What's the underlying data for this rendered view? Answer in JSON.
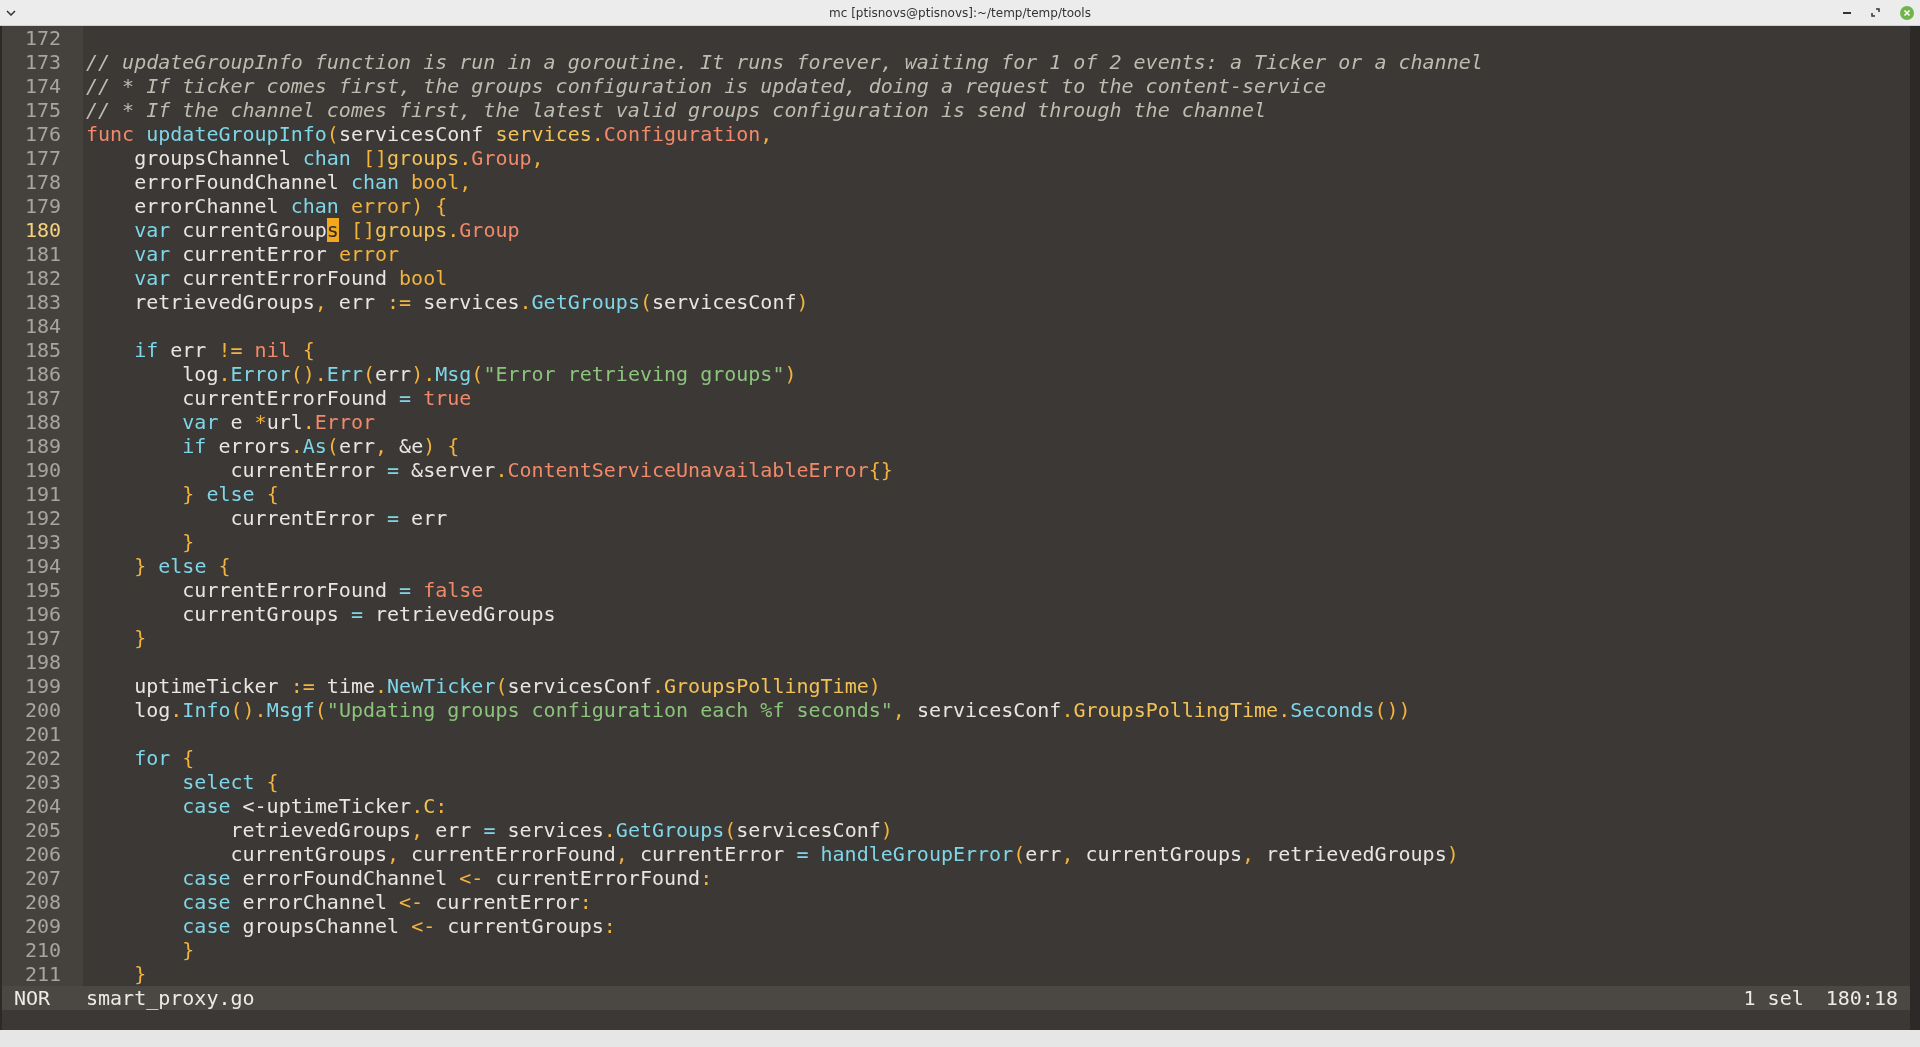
{
  "window": {
    "title": "mc [ptisnovs@ptisnovs]:~/temp/temp/tools"
  },
  "editor": {
    "lines": [
      {
        "number": "172",
        "current": false
      },
      {
        "number": "173",
        "current": false,
        "tokens": [
          {
            "kind": "comment",
            "text": "// updateGroupInfo function is run in a goroutine. It runs forever, waiting for 1 of 2 events: a Ticker or a channel"
          }
        ]
      },
      {
        "number": "174",
        "current": false,
        "tokens": [
          {
            "kind": "comment",
            "text": "// * If ticker comes first, the groups configuration is updated, doing a request to the content-service"
          }
        ]
      },
      {
        "number": "175",
        "current": false,
        "tokens": [
          {
            "kind": "comment",
            "text": "// * If the channel comes first, the latest valid groups configuration is send through the channel"
          }
        ]
      },
      {
        "number": "176",
        "current": false,
        "tokens": [
          {
            "kind": "keyword",
            "text": "func"
          },
          {
            "kind": "function",
            "text": " updateGroupInfo"
          },
          {
            "kind": "punctuation",
            "text": "("
          },
          {
            "kind": "plain",
            "text": "servicesConf "
          },
          {
            "kind": "field",
            "text": "services"
          },
          {
            "kind": "punctuation",
            "text": "."
          },
          {
            "kind": "type",
            "text": "Configuration"
          },
          {
            "kind": "punctuation",
            "text": ","
          }
        ]
      },
      {
        "number": "177",
        "current": false,
        "tokens": [
          {
            "kind": "plain",
            "text": "    groupsChannel "
          },
          {
            "kind": "control",
            "text": "chan"
          },
          {
            "kind": "punctuation",
            "text": " []"
          },
          {
            "kind": "field",
            "text": "groups"
          },
          {
            "kind": "punctuation",
            "text": "."
          },
          {
            "kind": "type",
            "text": "Group"
          },
          {
            "kind": "punctuation",
            "text": ","
          }
        ]
      },
      {
        "number": "178",
        "current": false,
        "tokens": [
          {
            "kind": "plain",
            "text": "    errorFoundChannel "
          },
          {
            "kind": "control",
            "text": "chan"
          },
          {
            "kind": "builtin",
            "text": " bool"
          },
          {
            "kind": "punctuation",
            "text": ","
          }
        ]
      },
      {
        "number": "179",
        "current": false,
        "tokens": [
          {
            "kind": "plain",
            "text": "    errorChannel "
          },
          {
            "kind": "control",
            "text": "chan"
          },
          {
            "kind": "builtin",
            "text": " error"
          },
          {
            "kind": "punctuation",
            "text": ") {"
          }
        ]
      },
      {
        "number": "180",
        "current": true,
        "tokens": [
          {
            "kind": "control",
            "text": "    var"
          },
          {
            "kind": "plain",
            "text": " currentGroup"
          },
          {
            "kind": "cursor",
            "text": "s"
          },
          {
            "kind": "punctuation",
            "text": " []"
          },
          {
            "kind": "field",
            "text": "groups"
          },
          {
            "kind": "punctuation",
            "text": "."
          },
          {
            "kind": "type",
            "text": "Group"
          }
        ]
      },
      {
        "number": "181",
        "current": false,
        "tokens": [
          {
            "kind": "control",
            "text": "    var"
          },
          {
            "kind": "plain",
            "text": " currentError "
          },
          {
            "kind": "builtin",
            "text": "error"
          }
        ]
      },
      {
        "number": "182",
        "current": false,
        "tokens": [
          {
            "kind": "control",
            "text": "    var"
          },
          {
            "kind": "plain",
            "text": " currentErrorFound "
          },
          {
            "kind": "builtin",
            "text": "bool"
          }
        ]
      },
      {
        "number": "183",
        "current": false,
        "tokens": [
          {
            "kind": "plain",
            "text": "    retrievedGroups"
          },
          {
            "kind": "punctuation",
            "text": ","
          },
          {
            "kind": "plain",
            "text": " err "
          },
          {
            "kind": "punctuation",
            "text": ":="
          },
          {
            "kind": "plain",
            "text": " services"
          },
          {
            "kind": "punctuation",
            "text": "."
          },
          {
            "kind": "function",
            "text": "GetGroups"
          },
          {
            "kind": "punctuation",
            "text": "("
          },
          {
            "kind": "plain",
            "text": "servicesConf"
          },
          {
            "kind": "punctuation",
            "text": ")"
          }
        ]
      },
      {
        "number": "184",
        "current": false
      },
      {
        "number": "185",
        "current": false,
        "tokens": [
          {
            "kind": "control",
            "text": "    if"
          },
          {
            "kind": "plain",
            "text": " err "
          },
          {
            "kind": "punctuation",
            "text": "!="
          },
          {
            "kind": "keyword",
            "text": " nil"
          },
          {
            "kind": "punctuation",
            "text": " {"
          }
        ]
      },
      {
        "number": "186",
        "current": false,
        "tokens": [
          {
            "kind": "plain",
            "text": "        log"
          },
          {
            "kind": "punctuation",
            "text": "."
          },
          {
            "kind": "function",
            "text": "Error"
          },
          {
            "kind": "punctuation",
            "text": "()."
          },
          {
            "kind": "function",
            "text": "Err"
          },
          {
            "kind": "punctuation",
            "text": "("
          },
          {
            "kind": "plain",
            "text": "err"
          },
          {
            "kind": "punctuation",
            "text": ")."
          },
          {
            "kind": "function",
            "text": "Msg"
          },
          {
            "kind": "punctuation",
            "text": "("
          },
          {
            "kind": "string",
            "text": "\"Error retrieving groups\""
          },
          {
            "kind": "punctuation",
            "text": ")"
          }
        ]
      },
      {
        "number": "187",
        "current": false,
        "tokens": [
          {
            "kind": "plain",
            "text": "        currentErrorFound "
          },
          {
            "kind": "operator",
            "text": "="
          },
          {
            "kind": "keyword",
            "text": " true"
          }
        ]
      },
      {
        "number": "188",
        "current": false,
        "tokens": [
          {
            "kind": "control",
            "text": "        var"
          },
          {
            "kind": "plain",
            "text": " e "
          },
          {
            "kind": "punctuation",
            "text": "*"
          },
          {
            "kind": "plain",
            "text": "url"
          },
          {
            "kind": "punctuation",
            "text": "."
          },
          {
            "kind": "type",
            "text": "Error"
          }
        ]
      },
      {
        "number": "189",
        "current": false,
        "tokens": [
          {
            "kind": "control",
            "text": "        if"
          },
          {
            "kind": "plain",
            "text": " errors"
          },
          {
            "kind": "punctuation",
            "text": "."
          },
          {
            "kind": "function",
            "text": "As"
          },
          {
            "kind": "punctuation",
            "text": "("
          },
          {
            "kind": "plain",
            "text": "err"
          },
          {
            "kind": "punctuation",
            "text": ","
          },
          {
            "kind": "plain",
            "text": " &e"
          },
          {
            "kind": "punctuation",
            "text": ") {"
          }
        ]
      },
      {
        "number": "190",
        "current": false,
        "tokens": [
          {
            "kind": "plain",
            "text": "            currentError "
          },
          {
            "kind": "operator",
            "text": "="
          },
          {
            "kind": "plain",
            "text": " &server"
          },
          {
            "kind": "punctuation",
            "text": "."
          },
          {
            "kind": "type",
            "text": "ContentServiceUnavailableError"
          },
          {
            "kind": "punctuation",
            "text": "{}"
          }
        ]
      },
      {
        "number": "191",
        "current": false,
        "tokens": [
          {
            "kind": "punctuation",
            "text": "        }"
          },
          {
            "kind": "control",
            "text": " else"
          },
          {
            "kind": "punctuation",
            "text": " {"
          }
        ]
      },
      {
        "number": "192",
        "current": false,
        "tokens": [
          {
            "kind": "plain",
            "text": "            currentError "
          },
          {
            "kind": "operator",
            "text": "="
          },
          {
            "kind": "plain",
            "text": " err"
          }
        ]
      },
      {
        "number": "193",
        "current": false,
        "tokens": [
          {
            "kind": "punctuation",
            "text": "        }"
          }
        ]
      },
      {
        "number": "194",
        "current": false,
        "tokens": [
          {
            "kind": "punctuation",
            "text": "    }"
          },
          {
            "kind": "control",
            "text": " else"
          },
          {
            "kind": "punctuation",
            "text": " {"
          }
        ]
      },
      {
        "number": "195",
        "current": false,
        "tokens": [
          {
            "kind": "plain",
            "text": "        currentErrorFound "
          },
          {
            "kind": "operator",
            "text": "="
          },
          {
            "kind": "keyword",
            "text": " false"
          }
        ]
      },
      {
        "number": "196",
        "current": false,
        "tokens": [
          {
            "kind": "plain",
            "text": "        currentGroups "
          },
          {
            "kind": "operator",
            "text": "="
          },
          {
            "kind": "plain",
            "text": " retrievedGroups"
          }
        ]
      },
      {
        "number": "197",
        "current": false,
        "tokens": [
          {
            "kind": "punctuation",
            "text": "    }"
          }
        ]
      },
      {
        "number": "198",
        "current": false
      },
      {
        "number": "199",
        "current": false,
        "tokens": [
          {
            "kind": "plain",
            "text": "    uptimeTicker "
          },
          {
            "kind": "punctuation",
            "text": ":="
          },
          {
            "kind": "plain",
            "text": " time"
          },
          {
            "kind": "punctuation",
            "text": "."
          },
          {
            "kind": "function",
            "text": "NewTicker"
          },
          {
            "kind": "punctuation",
            "text": "("
          },
          {
            "kind": "plain",
            "text": "servicesConf"
          },
          {
            "kind": "punctuation",
            "text": "."
          },
          {
            "kind": "field",
            "text": "GroupsPollingTime"
          },
          {
            "kind": "punctuation",
            "text": ")"
          }
        ]
      },
      {
        "number": "200",
        "current": false,
        "tokens": [
          {
            "kind": "plain",
            "text": "    log"
          },
          {
            "kind": "punctuation",
            "text": "."
          },
          {
            "kind": "function",
            "text": "Info"
          },
          {
            "kind": "punctuation",
            "text": "()."
          },
          {
            "kind": "function",
            "text": "Msgf"
          },
          {
            "kind": "punctuation",
            "text": "("
          },
          {
            "kind": "string",
            "text": "\"Updating groups configuration each %f seconds\""
          },
          {
            "kind": "punctuation",
            "text": ","
          },
          {
            "kind": "plain",
            "text": " servicesConf"
          },
          {
            "kind": "punctuation",
            "text": "."
          },
          {
            "kind": "field",
            "text": "GroupsPollingTime"
          },
          {
            "kind": "punctuation",
            "text": "."
          },
          {
            "kind": "function",
            "text": "Seconds"
          },
          {
            "kind": "punctuation",
            "text": "())"
          }
        ]
      },
      {
        "number": "201",
        "current": false
      },
      {
        "number": "202",
        "current": false,
        "tokens": [
          {
            "kind": "control",
            "text": "    for"
          },
          {
            "kind": "punctuation",
            "text": " {"
          }
        ]
      },
      {
        "number": "203",
        "current": false,
        "tokens": [
          {
            "kind": "control",
            "text": "        select"
          },
          {
            "kind": "punctuation",
            "text": " {"
          }
        ]
      },
      {
        "number": "204",
        "current": false,
        "tokens": [
          {
            "kind": "control",
            "text": "        case"
          },
          {
            "kind": "plain",
            "text": " <-uptimeTicker"
          },
          {
            "kind": "punctuation",
            "text": "."
          },
          {
            "kind": "field",
            "text": "C"
          },
          {
            "kind": "punctuation",
            "text": ":"
          }
        ]
      },
      {
        "number": "205",
        "current": false,
        "tokens": [
          {
            "kind": "plain",
            "text": "            retrievedGroups"
          },
          {
            "kind": "punctuation",
            "text": ","
          },
          {
            "kind": "plain",
            "text": " err "
          },
          {
            "kind": "operator",
            "text": "="
          },
          {
            "kind": "plain",
            "text": " services"
          },
          {
            "kind": "punctuation",
            "text": "."
          },
          {
            "kind": "function",
            "text": "GetGroups"
          },
          {
            "kind": "punctuation",
            "text": "("
          },
          {
            "kind": "plain",
            "text": "servicesConf"
          },
          {
            "kind": "punctuation",
            "text": ")"
          }
        ]
      },
      {
        "number": "206",
        "current": false,
        "tokens": [
          {
            "kind": "plain",
            "text": "            currentGroups"
          },
          {
            "kind": "punctuation",
            "text": ","
          },
          {
            "kind": "plain",
            "text": " currentErrorFound"
          },
          {
            "kind": "punctuation",
            "text": ","
          },
          {
            "kind": "plain",
            "text": " currentError "
          },
          {
            "kind": "operator",
            "text": "="
          },
          {
            "kind": "function",
            "text": " handleGroupError"
          },
          {
            "kind": "punctuation",
            "text": "("
          },
          {
            "kind": "plain",
            "text": "err"
          },
          {
            "kind": "punctuation",
            "text": ","
          },
          {
            "kind": "plain",
            "text": " currentGroups"
          },
          {
            "kind": "punctuation",
            "text": ","
          },
          {
            "kind": "plain",
            "text": " retrievedGroups"
          },
          {
            "kind": "punctuation",
            "text": ")"
          }
        ]
      },
      {
        "number": "207",
        "current": false,
        "tokens": [
          {
            "kind": "control",
            "text": "        case"
          },
          {
            "kind": "plain",
            "text": " errorFoundChannel "
          },
          {
            "kind": "punctuation",
            "text": "<-"
          },
          {
            "kind": "plain",
            "text": " currentErrorFound"
          },
          {
            "kind": "punctuation",
            "text": ":"
          }
        ]
      },
      {
        "number": "208",
        "current": false,
        "tokens": [
          {
            "kind": "control",
            "text": "        case"
          },
          {
            "kind": "plain",
            "text": " errorChannel "
          },
          {
            "kind": "punctuation",
            "text": "<-"
          },
          {
            "kind": "plain",
            "text": " currentError"
          },
          {
            "kind": "punctuation",
            "text": ":"
          }
        ]
      },
      {
        "number": "209",
        "current": false,
        "tokens": [
          {
            "kind": "control",
            "text": "        case"
          },
          {
            "kind": "plain",
            "text": " groupsChannel "
          },
          {
            "kind": "punctuation",
            "text": "<-"
          },
          {
            "kind": "plain",
            "text": " currentGroups"
          },
          {
            "kind": "punctuation",
            "text": ":"
          }
        ]
      },
      {
        "number": "210",
        "current": false,
        "tokens": [
          {
            "kind": "punctuation",
            "text": "        }"
          }
        ]
      },
      {
        "number": "211",
        "current": false,
        "tokens": [
          {
            "kind": "punctuation",
            "text": "    }"
          }
        ]
      }
    ]
  },
  "status_bar": {
    "mode": "NOR",
    "file": "smart_proxy.go",
    "selections": "1 sel",
    "position": "180:18"
  }
}
